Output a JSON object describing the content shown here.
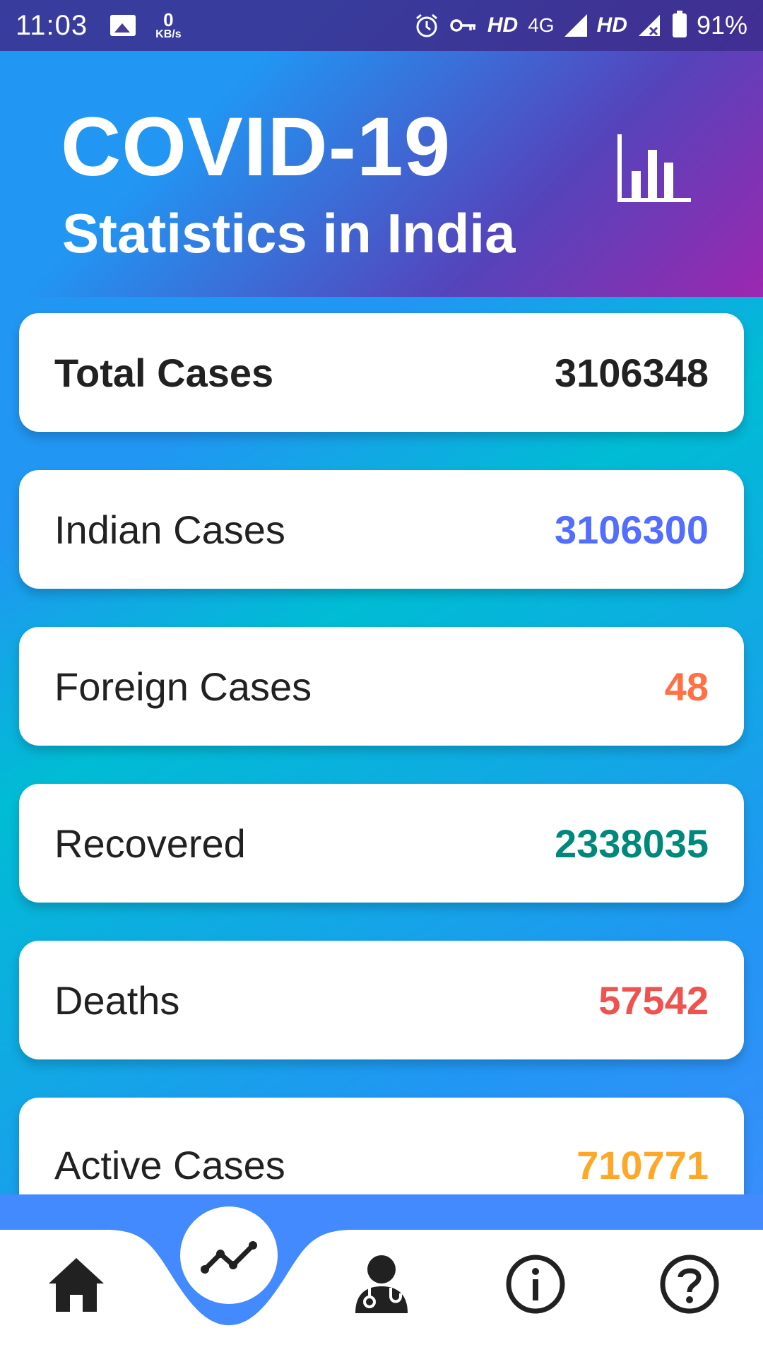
{
  "status_bar": {
    "time": "11:03",
    "speed_value": "0",
    "speed_unit": "KB/s",
    "hd1": "HD",
    "network": "4G",
    "hd2": "HD",
    "battery": "91%"
  },
  "header": {
    "title": "COVID-19",
    "subtitle": "Statistics in India",
    "icon": "bar-chart-icon"
  },
  "stats": {
    "total": {
      "label": "Total Cases",
      "value": "3106348",
      "color": "#212121"
    },
    "indian": {
      "label": "Indian Cases",
      "value": "3106300",
      "color": "#536dfe"
    },
    "foreign": {
      "label": "Foreign Cases",
      "value": "48",
      "color": "#ff7043"
    },
    "recovered": {
      "label": "Recovered",
      "value": "2338035",
      "color": "#00897b"
    },
    "deaths": {
      "label": "Deaths",
      "value": "57542",
      "color": "#ef5350"
    },
    "active": {
      "label": "Active Cases",
      "value": "710771",
      "color": "#ffa726"
    }
  },
  "bottom_nav": {
    "items": [
      "home-icon",
      "trend-icon",
      "doctor-icon",
      "info-icon",
      "help-icon"
    ],
    "active": "trend-icon",
    "accent": "#448aff"
  }
}
